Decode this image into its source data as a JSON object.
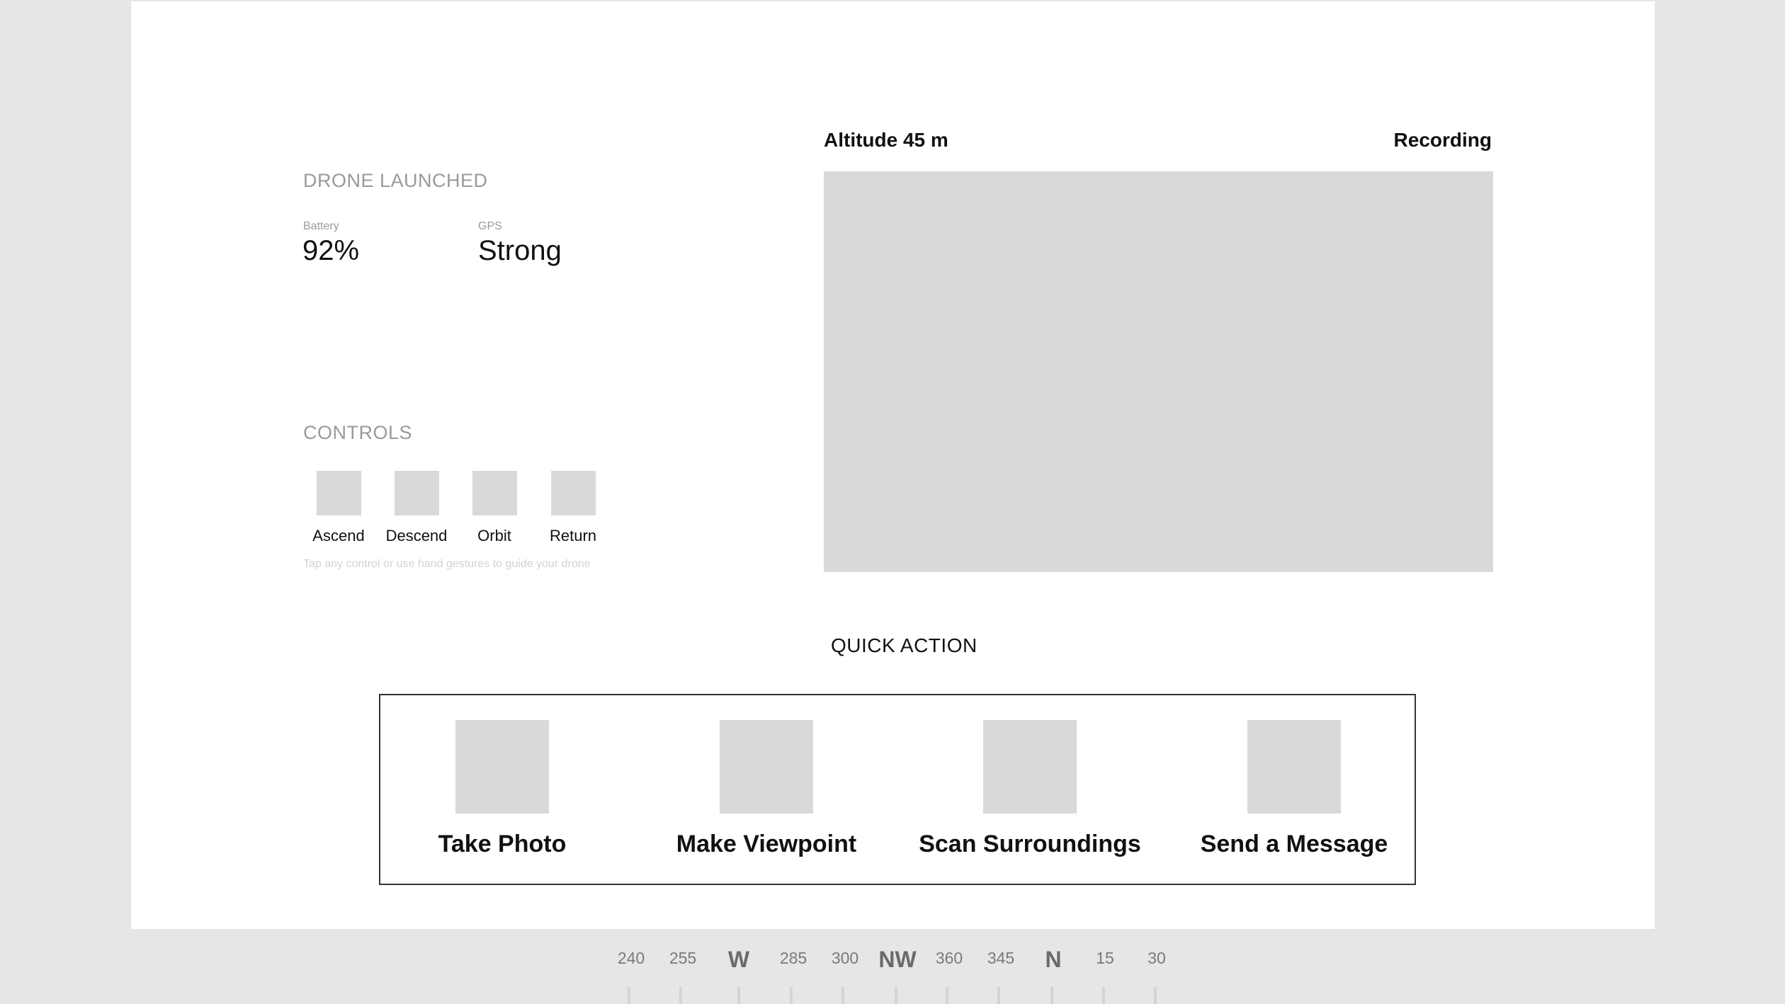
{
  "status": {
    "title": "DRONE LAUNCHED",
    "battery_label": "Battery",
    "battery_value": "92%",
    "gps_label": "GPS",
    "gps_value": "Strong"
  },
  "controls": {
    "title": "CONTROLS",
    "buttons": [
      {
        "label": "Ascend"
      },
      {
        "label": "Descend"
      },
      {
        "label": "Orbit"
      },
      {
        "label": "Return"
      }
    ],
    "hint": "Tap any control or use hand gestures to guide your drone"
  },
  "video": {
    "altitude": "Altitude 45 m",
    "recording": "Recording"
  },
  "quick_action": {
    "title": "QUICK ACTION",
    "actions": [
      {
        "label": "Take Photo"
      },
      {
        "label": "Make Viewpoint"
      },
      {
        "label": "Scan Surroundings"
      },
      {
        "label": "Send a Message"
      }
    ]
  },
  "compass": {
    "labels": [
      "240",
      "255",
      "W",
      "285",
      "300",
      "NW",
      "360",
      "345",
      "N",
      "15",
      "30"
    ]
  },
  "colors": {
    "background": "#e6e6e6",
    "panel": "#ffffff",
    "placeholder": "#d9d9d9",
    "muted_text": "#9a9a9a"
  }
}
